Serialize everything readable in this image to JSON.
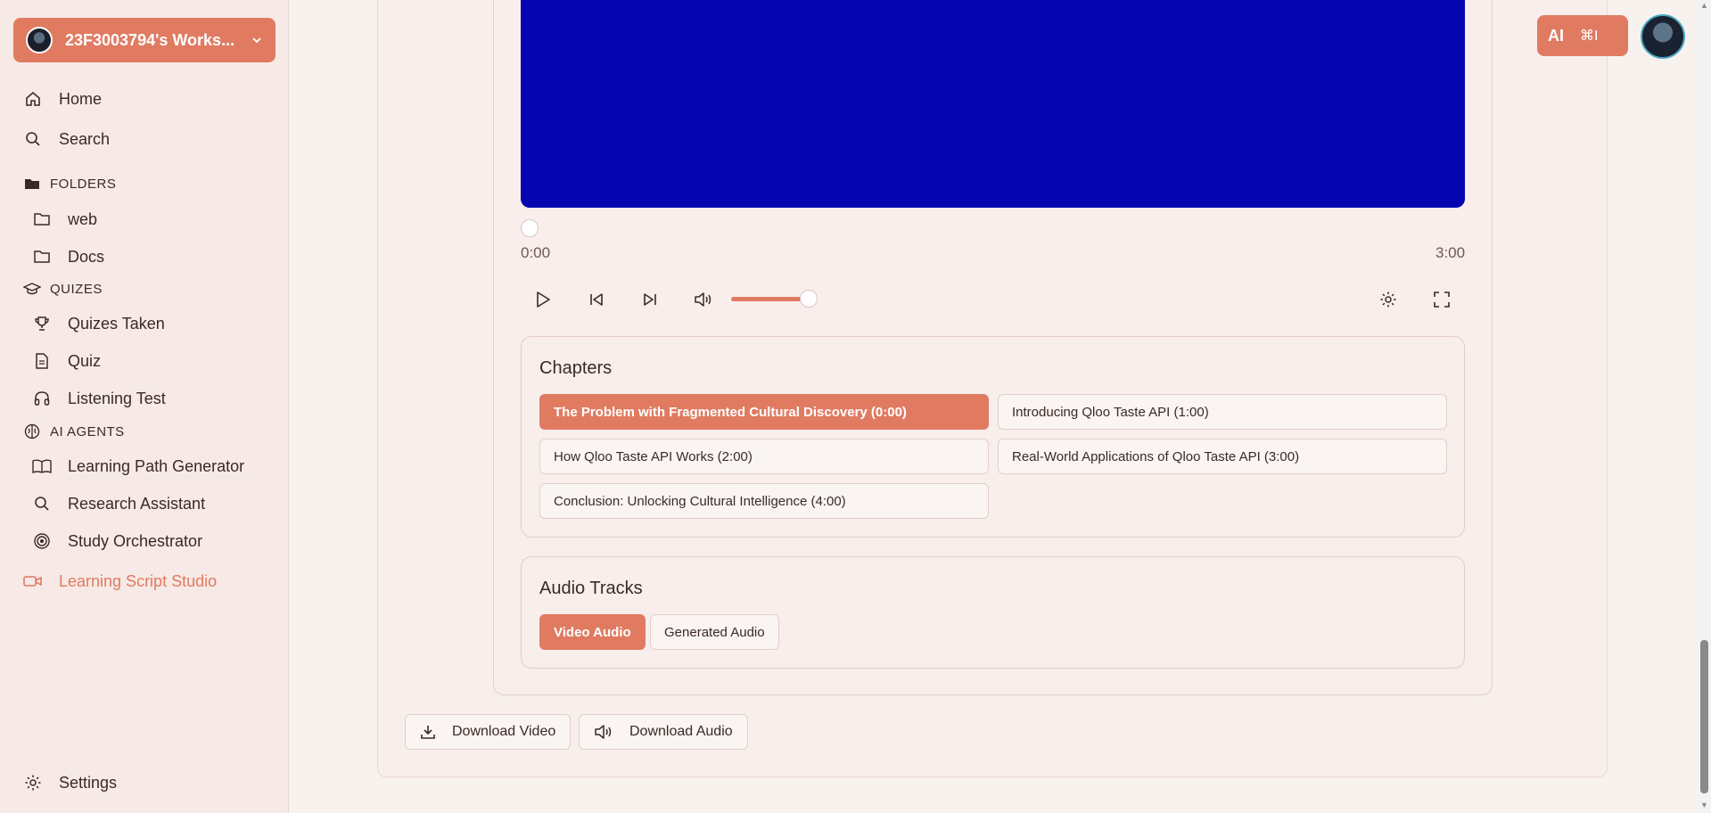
{
  "workspace": {
    "name": "23F3003794's Works...",
    "chevron_icon": "chevron-down-icon"
  },
  "sidebar": {
    "home": "Home",
    "search": "Search",
    "folders_header": "FOLDERS",
    "folders": [
      "web",
      "Docs"
    ],
    "quizes_header": "QUIZES",
    "quizes": [
      "Quizes Taken",
      "Quiz",
      "Listening Test"
    ],
    "agents_header": "AI AGENTS",
    "agents": [
      "Learning Path Generator",
      "Research Assistant",
      "Study Orchestrator"
    ],
    "studio": "Learning Script Studio",
    "settings": "Settings"
  },
  "player": {
    "current_time": "0:00",
    "duration": "3:00",
    "progress": 0,
    "volume": 0.85,
    "video_color": "#0606b0"
  },
  "chapters": {
    "title": "Chapters",
    "items": [
      "The Problem with Fragmented Cultural Discovery (0:00)",
      "Introducing Qloo Taste API (1:00)",
      "How Qloo Taste API Works (2:00)",
      "Real-World Applications of Qloo Taste API (3:00)",
      "Conclusion: Unlocking Cultural Intelligence (4:00)"
    ],
    "active_index": 0
  },
  "audio_tracks": {
    "title": "Audio Tracks",
    "items": [
      "Video Audio",
      "Generated Audio"
    ],
    "active_index": 0
  },
  "downloads": {
    "video": "Download Video",
    "audio": "Download Audio"
  },
  "header": {
    "ai_label": "AI",
    "ai_shortcut": "⌘I"
  },
  "colors": {
    "accent": "#e07b62",
    "sidebar_bg": "#f7e9e5",
    "page_bg": "#f8f2ef"
  }
}
